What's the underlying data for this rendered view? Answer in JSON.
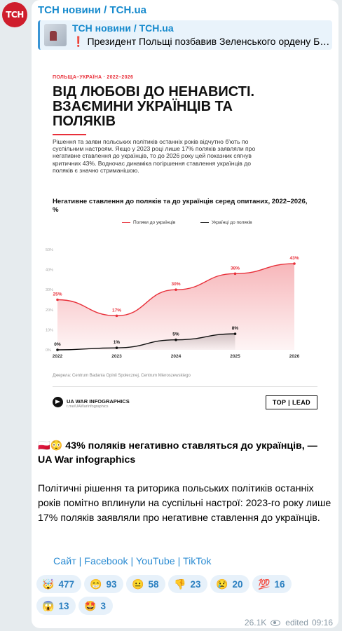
{
  "channel": {
    "avatar_text": "ТСН",
    "name": "ТСН новини / ТСН.ua"
  },
  "reply": {
    "title": "ТСН новини / ТСН.ua",
    "emoji": "❗",
    "text": "Президент Польщі позбавив Зеленського ордену Білого Орла"
  },
  "infographic": {
    "kicker": "ПОЛЬЩА–УКРАЇНА · 2022–2026",
    "headline": "ВІД ЛЮБОВІ ДО НЕНАВИСТІ. ВЗАЄМИНИ УКРАЇНЦІВ ТА ПОЛЯКІВ",
    "body": "Рішення та заяви польських політиків останніх років відчутно б'ють по суспільним настроям. Якщо у 2023 році лише 17% поляків заявляли про негативне ставлення до українців, то до 2026 року цей показник сягнув критичних 43%. Водночас динаміка погіршення ставлення українців до поляків є значно стриманішою.",
    "chart_title": "Негативне ставлення до поляків та до українців серед опитаних, 2022–2026, %",
    "source": "Джерела: Centrum Badania Opinii Społecznej, Centrum Mieroszewskiego",
    "brand_name": "UA WAR INFOGRAPHICS",
    "brand_link": "t.me/UAWarInfographics",
    "toplead": "TOP | LEAD"
  },
  "chart_data": {
    "type": "area",
    "x": [
      "2022",
      "2023",
      "2024",
      "2025",
      "2026"
    ],
    "y_ticks": [
      "0%",
      "10%",
      "20%",
      "30%",
      "40%",
      "50%"
    ],
    "ylim": [
      0,
      50
    ],
    "series": [
      {
        "name": "Поляки до українців",
        "color": "#e8303a",
        "values": [
          25,
          17,
          30,
          38,
          43
        ],
        "labels": [
          "25%",
          "17%",
          "30%",
          "38%",
          "43%"
        ]
      },
      {
        "name": "Українці до поляків",
        "color": "#111111",
        "values": [
          0,
          1,
          5,
          8,
          null
        ],
        "labels": [
          "0%",
          "1%",
          "5%",
          "8%",
          ""
        ]
      }
    ],
    "legend": "top"
  },
  "message": {
    "headline_emoji": "🇵🇱😳",
    "headline": " 43% поляків негативно ставляться до українців, — UA War infographics",
    "body": "Політичні рішення та риторика польських політиків останніх років помітно вплинули на суспільні настрої: 2023-го року лише 17% поляків заявляли про негативне ставлення до українців.",
    "links": [
      "Сайт",
      "Facebook",
      "YouTube",
      "TikTok"
    ],
    "link_sep": " | "
  },
  "reactions": [
    {
      "emoji": "🤯",
      "count": "477"
    },
    {
      "emoji": "😁",
      "count": "93"
    },
    {
      "emoji": "😐",
      "count": "58"
    },
    {
      "emoji": "👎",
      "count": "23"
    },
    {
      "emoji": "😢",
      "count": "20"
    },
    {
      "emoji": "💯",
      "count": "16"
    },
    {
      "emoji": "😱",
      "count": "13"
    },
    {
      "emoji": "🤩",
      "count": "3"
    }
  ],
  "meta": {
    "views": "26.1K",
    "edited": "edited",
    "time": "09:16"
  }
}
